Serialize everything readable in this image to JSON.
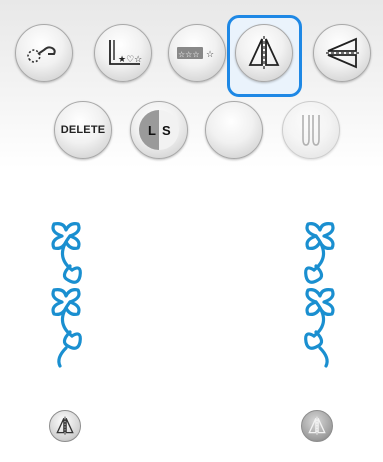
{
  "toolbar_row1": [
    {
      "name": "thread-cutter-button",
      "icon": "thread-cutter-icon"
    },
    {
      "name": "single-or-repeat-button",
      "icon": "single-repeat-icon"
    },
    {
      "name": "pattern-repeat-button",
      "icon": "stars-repeat-icon"
    },
    {
      "name": "mirror-image-button",
      "icon": "mirror-vertical-icon",
      "selected": true
    },
    {
      "name": "horizontal-mirror-button",
      "icon": "mirror-horizontal-icon"
    }
  ],
  "toolbar_row2": {
    "delete_label": "DELETE",
    "ls_left": "L",
    "ls_right": "S"
  },
  "preview": {
    "left_pattern": "original-stitch-pattern",
    "right_pattern": "mirrored-stitch-pattern"
  },
  "accent_color": "#1e88e5",
  "stitch_color": "#1a8fd0"
}
